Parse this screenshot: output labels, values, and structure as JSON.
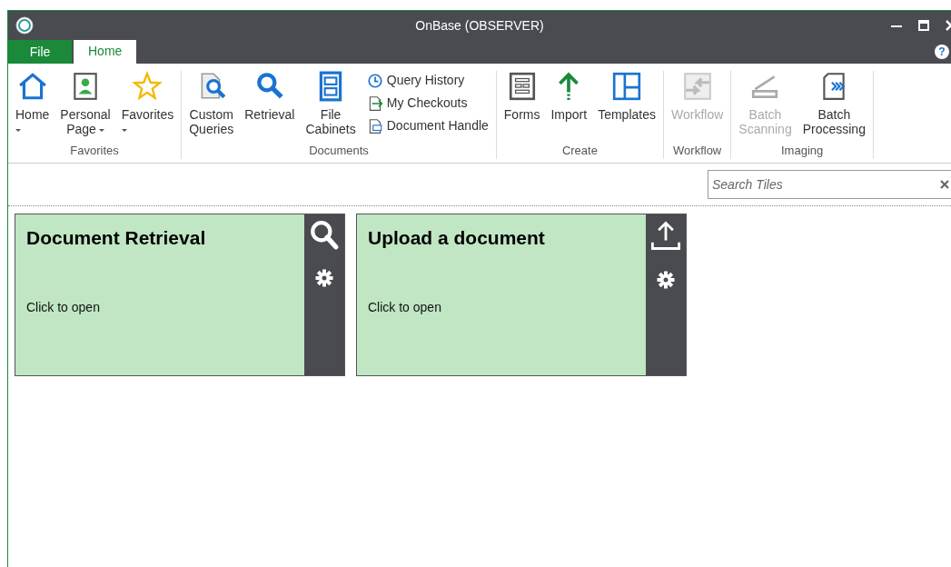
{
  "window": {
    "title": "OnBase (OBSERVER)",
    "help": "?"
  },
  "tabs": [
    {
      "label": "File",
      "kind": "file",
      "selected": false
    },
    {
      "label": "Home",
      "kind": "tab",
      "selected": true
    }
  ],
  "ribbon": {
    "groups": [
      {
        "label": "Favorites",
        "items": [
          {
            "kind": "large",
            "label": "Home",
            "dropdown": true,
            "disabled": false
          },
          {
            "kind": "large",
            "label": "Personal\nPage",
            "dropdown": true,
            "disabled": false
          },
          {
            "kind": "large",
            "label": "Favorites",
            "dropdown": true,
            "disabled": false
          }
        ]
      },
      {
        "label": "Documents",
        "items": [
          {
            "kind": "large",
            "label": "Custom\nQueries",
            "dropdown": false,
            "disabled": false
          },
          {
            "kind": "large",
            "label": "Retrieval",
            "dropdown": false,
            "disabled": false
          },
          {
            "kind": "large",
            "label": "File\nCabinets",
            "dropdown": false,
            "disabled": false
          },
          {
            "kind": "small",
            "label": "Query History",
            "disabled": false
          },
          {
            "kind": "small",
            "label": "My Checkouts",
            "disabled": false
          },
          {
            "kind": "small",
            "label": "Document Handle",
            "disabled": false
          }
        ]
      },
      {
        "label": "Create",
        "items": [
          {
            "kind": "large",
            "label": "Forms",
            "dropdown": false,
            "disabled": false
          },
          {
            "kind": "large",
            "label": "Import",
            "dropdown": false,
            "disabled": false
          },
          {
            "kind": "large",
            "label": "Templates",
            "dropdown": false,
            "disabled": false
          }
        ]
      },
      {
        "label": "Workflow",
        "items": [
          {
            "kind": "large",
            "label": "Workflow",
            "dropdown": false,
            "disabled": true
          }
        ]
      },
      {
        "label": "Imaging",
        "items": [
          {
            "kind": "large",
            "label": "Batch\nScanning",
            "dropdown": false,
            "disabled": true
          },
          {
            "kind": "large",
            "label": "Batch\nProcessing",
            "dropdown": false,
            "disabled": false
          }
        ]
      }
    ]
  },
  "search": {
    "placeholder": "Search Tiles"
  },
  "tiles": [
    {
      "title": "Document Retrieval",
      "subtitle": "Click to open"
    },
    {
      "title": "Upload a document",
      "subtitle": "Click to open"
    }
  ]
}
